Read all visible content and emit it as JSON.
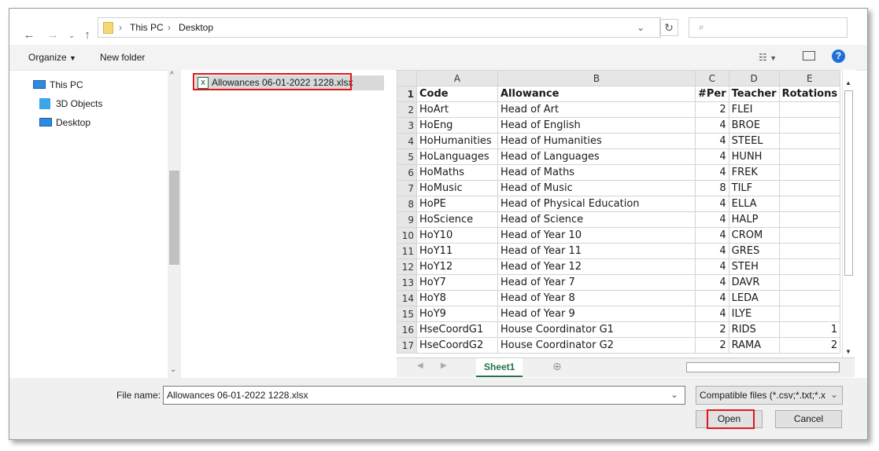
{
  "address": {
    "crumbs": [
      "This PC",
      "Desktop"
    ]
  },
  "toolbar": {
    "organize_label": "Organize",
    "new_folder_label": "New folder"
  },
  "nav_tree": {
    "items": [
      "This PC",
      "3D Objects",
      "Desktop"
    ]
  },
  "files": [
    {
      "name": "Allowances 06-01-2022 1228.xlsx",
      "selected": true
    }
  ],
  "preview": {
    "columns": [
      "A",
      "B",
      "C",
      "D",
      "E"
    ],
    "rows": [
      [
        "1",
        "Code",
        "Allowance",
        "#Per",
        "Teacher",
        "Rotations"
      ],
      [
        "2",
        "HoArt",
        "Head of Art",
        "2",
        "FLEI",
        ""
      ],
      [
        "3",
        "HoEng",
        "Head of English",
        "4",
        "BROE",
        ""
      ],
      [
        "4",
        "HoHumanities",
        "Head of Humanities",
        "4",
        "STEEL",
        ""
      ],
      [
        "5",
        "HoLanguages",
        "Head of Languages",
        "4",
        "HUNH",
        ""
      ],
      [
        "6",
        "HoMaths",
        "Head of Maths",
        "4",
        "FREK",
        ""
      ],
      [
        "7",
        "HoMusic",
        "Head of Music",
        "8",
        "TILF",
        ""
      ],
      [
        "8",
        "HoPE",
        "Head of Physical Education",
        "4",
        "ELLA",
        ""
      ],
      [
        "9",
        "HoScience",
        "Head of Science",
        "4",
        "HALP",
        ""
      ],
      [
        "10",
        "HoY10",
        "Head of Year 10",
        "4",
        "CROM",
        ""
      ],
      [
        "11",
        "HoY11",
        "Head of Year 11",
        "4",
        "GRES",
        ""
      ],
      [
        "12",
        "HoY12",
        "Head of Year 12",
        "4",
        "STEH",
        ""
      ],
      [
        "13",
        "HoY7",
        "Head of Year 7",
        "4",
        "DAVR",
        ""
      ],
      [
        "14",
        "HoY8",
        "Head of Year 8",
        "4",
        "LEDA",
        ""
      ],
      [
        "15",
        "HoY9",
        "Head of Year 9",
        "4",
        "ILYE",
        ""
      ],
      [
        "16",
        "HseCoordG1",
        "House Coordinator G1",
        "2",
        "RIDS",
        "1"
      ],
      [
        "17",
        "HseCoordG2",
        "House Coordinator G2",
        "2",
        "RAMA",
        "2"
      ]
    ],
    "sheet_tab": "Sheet1"
  },
  "bottom": {
    "file_name_label": "File name:",
    "file_name_value": "Allowances 06-01-2022 1228.xlsx",
    "filter_value": "Compatible files (*.csv;*.txt;*.xl",
    "open_label": "Open",
    "cancel_label": "Cancel"
  },
  "colors": {
    "highlight": "#e0161b",
    "sheet_tab_green": "#217346",
    "help_blue": "#1e6fd9"
  }
}
